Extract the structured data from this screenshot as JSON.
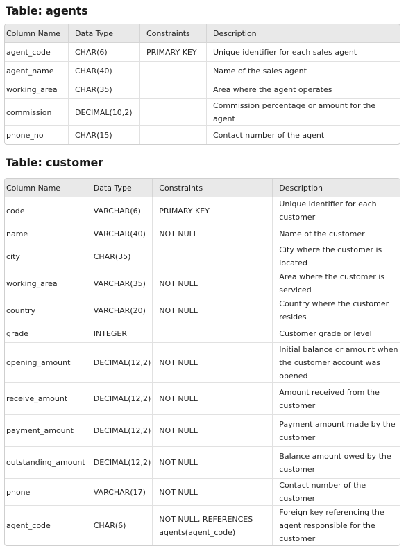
{
  "agents": {
    "title": "Table: agents",
    "headers": [
      "Column Name",
      "Data Type",
      "Constraints",
      "Description"
    ],
    "rows": [
      [
        "agent_code",
        "CHAR(6)",
        "PRIMARY KEY",
        "Unique identifier for each sales agent"
      ],
      [
        "agent_name",
        "CHAR(40)",
        "",
        "Name of the sales agent"
      ],
      [
        "working_area",
        "CHAR(35)",
        "",
        "Area where the agent operates"
      ],
      [
        "commission",
        "DECIMAL(10,2)",
        "",
        "Commission percentage or amount for the agent"
      ],
      [
        "phone_no",
        "CHAR(15)",
        "",
        "Contact number of the agent"
      ]
    ]
  },
  "customer": {
    "title": "Table: customer",
    "headers": [
      "Column Name",
      "Data Type",
      "Constraints",
      "Description"
    ],
    "rows": [
      [
        "code",
        "VARCHAR(6)",
        "PRIMARY KEY",
        "Unique identifier for each customer"
      ],
      [
        "name",
        "VARCHAR(40)",
        "NOT NULL",
        "Name of the customer"
      ],
      [
        "city",
        "CHAR(35)",
        "",
        "City where the customer is located"
      ],
      [
        "working_area",
        "VARCHAR(35)",
        "NOT NULL",
        "Area where the customer is serviced"
      ],
      [
        "country",
        "VARCHAR(20)",
        "NOT NULL",
        "Country where the customer resides"
      ],
      [
        "grade",
        "INTEGER",
        "",
        "Customer grade or level"
      ],
      [
        "opening_amount",
        "DECIMAL(12,2)",
        "NOT NULL",
        "Initial balance or amount when the customer account was opened"
      ],
      [
        "receive_amount",
        "DECIMAL(12,2)",
        "NOT NULL",
        "Amount received from the customer"
      ],
      [
        "payment_amount",
        "DECIMAL(12,2)",
        "NOT NULL",
        "Payment amount made by the customer"
      ],
      [
        "outstanding_amount",
        "DECIMAL(12,2)",
        "NOT NULL",
        "Balance amount owed by the customer"
      ],
      [
        "phone",
        "VARCHAR(17)",
        "NOT NULL",
        "Contact number of the customer"
      ],
      [
        "agent_code",
        "CHAR(6)",
        "NOT NULL, REFERENCES agents(agent_code)",
        "Foreign key referencing the agent responsible for the customer"
      ]
    ]
  }
}
